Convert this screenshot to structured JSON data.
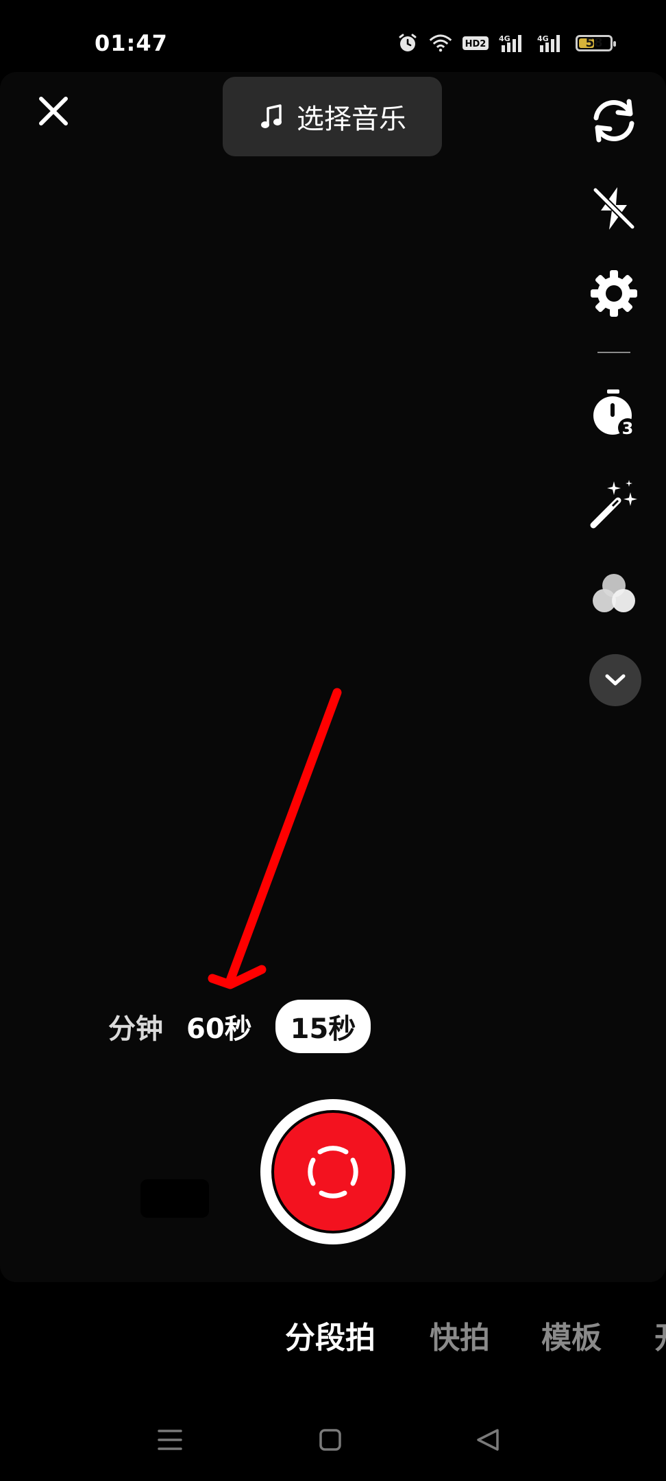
{
  "status_bar": {
    "time": "01:47",
    "hd_label": "HD2",
    "signal1_label": "4G",
    "signal2_label": "4G",
    "battery_level": "58",
    "battery_percent": 58,
    "icons": [
      "alarm-icon",
      "wifi-icon",
      "hd-icon",
      "signal-icon",
      "signal-icon",
      "battery-icon"
    ]
  },
  "top_bar": {
    "close_icon": "close-icon",
    "music_label": "选择音乐",
    "music_icon": "music-note-icon"
  },
  "right_toolbar": {
    "items": [
      {
        "name": "flip-camera-icon"
      },
      {
        "name": "flash-off-icon"
      },
      {
        "name": "settings-gear-icon"
      },
      {
        "name": "timer-icon",
        "badge": "3"
      },
      {
        "name": "beauty-wand-icon"
      },
      {
        "name": "filter-icon"
      },
      {
        "name": "more-chevron-down-icon"
      }
    ]
  },
  "duration_options": {
    "items": [
      "分钟",
      "60秒",
      "15秒"
    ],
    "selected": "15秒"
  },
  "modes": {
    "items": [
      "分段拍",
      "快拍",
      "模板",
      "开"
    ],
    "selected": "分段拍"
  },
  "nav_bar": {
    "icons": [
      "menu-icon",
      "home-icon",
      "back-icon"
    ]
  },
  "colors": {
    "record_red": "#f3121f",
    "background": "#000000",
    "annotation_red": "#ff0000",
    "battery_fill": "#d6b33a"
  }
}
